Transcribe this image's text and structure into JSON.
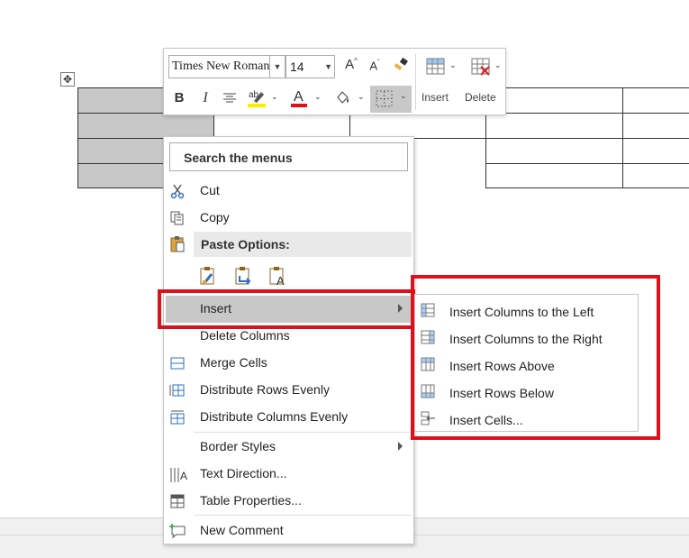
{
  "toolbar": {
    "font_name": "Times New Roman",
    "font_size": "14",
    "insert_label": "Insert",
    "delete_label": "Delete",
    "bold_label": "B",
    "italic_label": "I"
  },
  "search": {
    "placeholder": "Search the menus"
  },
  "menu": {
    "cut": "Cut",
    "copy": "Copy",
    "paste_options": "Paste Options:",
    "insert": "Insert",
    "delete_columns": "Delete Columns",
    "merge_cells": "Merge Cells",
    "distribute_rows": "Distribute Rows Evenly",
    "distribute_columns": "Distribute Columns Evenly",
    "border_styles": "Border Styles",
    "text_direction": "Text Direction...",
    "table_properties": "Table Properties...",
    "new_comment": "New Comment"
  },
  "submenu": {
    "items": [
      "Insert Columns to the Left",
      "Insert Columns to the Right",
      "Insert Rows Above",
      "Insert Rows Below",
      "Insert Cells..."
    ]
  },
  "colors": {
    "highlight": "#e0101a",
    "selection": "#c8c8c8"
  }
}
